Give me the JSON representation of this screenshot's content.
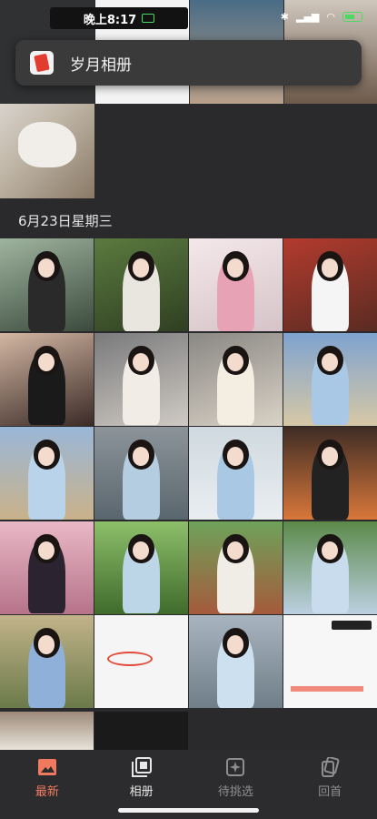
{
  "status_bar": {
    "time": "晚上8:17"
  },
  "album_banner": {
    "title": "岁月相册"
  },
  "section": {
    "date": "6月23日星期三"
  },
  "tabs": [
    {
      "label": "最新",
      "icon": "image-icon",
      "state": "active"
    },
    {
      "label": "相册",
      "icon": "album-icon",
      "state": "normal"
    },
    {
      "label": "待挑选",
      "icon": "sparkle-icon",
      "state": "dim"
    },
    {
      "label": "回首",
      "icon": "flip-icon",
      "state": "dim"
    }
  ],
  "colors": {
    "accent": "#f07a5f",
    "background": "#2a2a2c"
  }
}
